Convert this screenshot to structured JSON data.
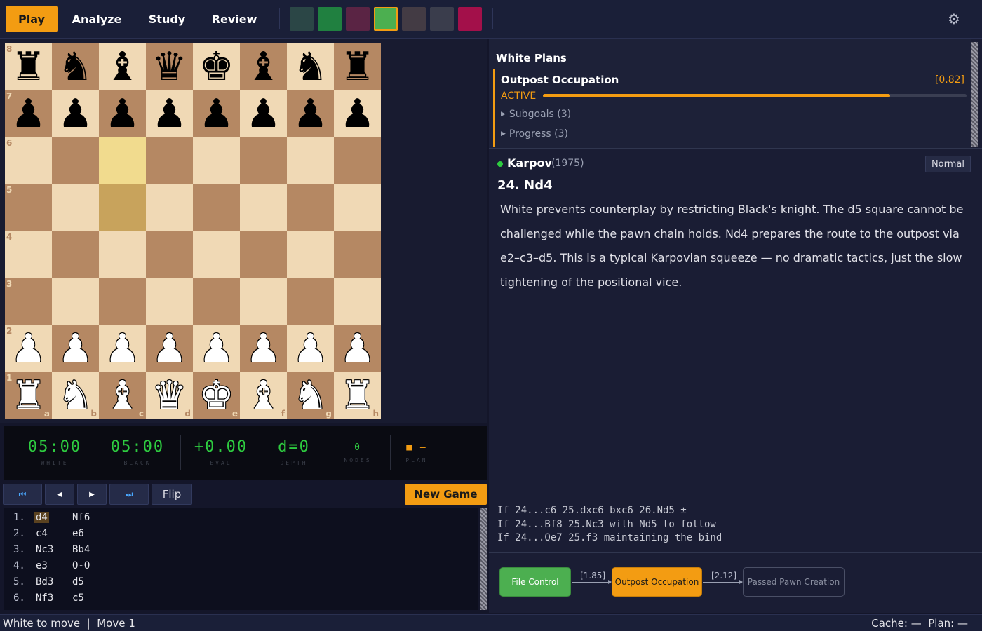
{
  "nav": {
    "tabs": [
      {
        "label": "Play",
        "active": true
      },
      {
        "label": "Analyze",
        "active": false
      },
      {
        "label": "Study",
        "active": false
      },
      {
        "label": "Review",
        "active": false
      }
    ],
    "swatches": [
      "#2b4646",
      "#208040",
      "#5a2444",
      "#4caf50",
      "#433b44",
      "#3a3d4c",
      "#a3104a"
    ],
    "selected_swatch": 3,
    "settings_icon": "gear-icon"
  },
  "board": {
    "ranks": [
      "8",
      "7",
      "6",
      "5",
      "4",
      "3",
      "2",
      "1"
    ],
    "files": [
      "a",
      "b",
      "c",
      "d",
      "e",
      "f",
      "g",
      "h"
    ],
    "position": [
      [
        "bR",
        "bN",
        "bB",
        "bQ",
        "bK",
        "bB",
        "bN",
        "bR"
      ],
      [
        "bP",
        "bP",
        "bP",
        "bP",
        "bP",
        "bP",
        "bP",
        "bP"
      ],
      [
        "",
        "",
        "",
        "",
        "",
        "",
        "",
        ""
      ],
      [
        "",
        "",
        "",
        "",
        "",
        "",
        "",
        ""
      ],
      [
        "",
        "",
        "",
        "",
        "",
        "",
        "",
        ""
      ],
      [
        "",
        "",
        "",
        "",
        "",
        "",
        "",
        ""
      ],
      [
        "wP",
        "wP",
        "wP",
        "wP",
        "wP",
        "wP",
        "wP",
        "wP"
      ],
      [
        "wR",
        "wN",
        "wB",
        "wQ",
        "wK",
        "wB",
        "wN",
        "wR"
      ]
    ],
    "highlighted": [
      "c6",
      "c5"
    ]
  },
  "clocks": [
    {
      "value": "05:00",
      "label": "WHITE"
    },
    {
      "value": "05:00",
      "label": "BLACK"
    },
    {
      "value": "+0.00",
      "label": "EVAL"
    },
    {
      "value": "d=0",
      "label": "DEPTH"
    },
    {
      "value": "0",
      "label": "NODES"
    },
    {
      "value": "—",
      "label": "PLAN"
    }
  ],
  "controls": {
    "first_icon": "skip-first-icon",
    "prev_icon": "step-back-icon",
    "next_icon": "step-forward-icon",
    "last_icon": "skip-last-icon",
    "flip_label": "Flip",
    "new_game_label": "New Game"
  },
  "moves": [
    {
      "num": "1.",
      "white": "d4",
      "black": "Nf6"
    },
    {
      "num": "2.",
      "white": "c4",
      "black": "e6"
    },
    {
      "num": "3.",
      "white": "Nc3",
      "black": "Bb4"
    },
    {
      "num": "4.",
      "white": "e3",
      "black": "O-O"
    },
    {
      "num": "5.",
      "white": "Bd3",
      "black": "d5"
    },
    {
      "num": "6.",
      "white": "Nf3",
      "black": "c5"
    }
  ],
  "plans": {
    "title": "White Plans",
    "name": "Outpost Occupation",
    "score": "[0.82]",
    "status": "ACTIVE",
    "progress": 0.82,
    "subgoals": "Subgoals (3)",
    "progress_label": "Progress (3)"
  },
  "commentary": {
    "author": "Karpov",
    "year": "(1975)",
    "badge": "Normal",
    "move": "24. Nd4",
    "text": "White prevents counterplay by restricting Black's knight. The d5 square cannot be challenged while the pawn chain holds. Nd4 prepares the route to the outpost via e2–c3–d5. This is a typical Karpovian squeeze — no dramatic tactics, just the slow tightening of the positional vice.",
    "lines": [
      "If 24...c6 25.dxc6 bxc6 26.Nd5 ±",
      "If 24...Bf8 25.Nc3 with Nd5 to follow",
      "If 24...Qe7 25.f3 maintaining the bind"
    ]
  },
  "flow": {
    "nodes": [
      "File Control",
      "Outpost Occupation",
      "Passed Pawn Creation"
    ],
    "edges": [
      "[1.85]",
      "[2.12]"
    ]
  },
  "status": {
    "left": "White to move  |  Move 1",
    "right": "Cache: —  Plan: —"
  }
}
